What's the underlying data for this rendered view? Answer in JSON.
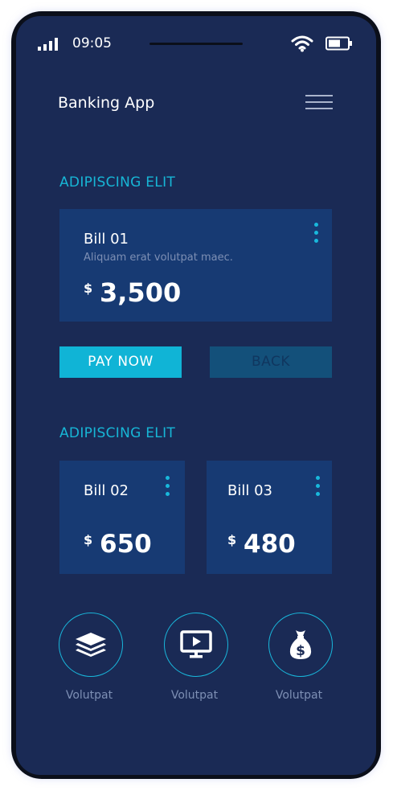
{
  "status_bar": {
    "time": "09:05"
  },
  "header": {
    "title": "Banking App"
  },
  "section1": {
    "title": "ADIPISCING ELIT",
    "bill": {
      "name": "Bill 01",
      "description": "Aliquam erat volutpat maec.",
      "currency": "$",
      "amount": "3,500"
    }
  },
  "actions": {
    "pay_label": "PAY NOW",
    "back_label": "BACK"
  },
  "section2": {
    "title": "ADIPISCING ELIT",
    "bills": [
      {
        "name": "Bill 02",
        "currency": "$",
        "amount": "650"
      },
      {
        "name": "Bill 03",
        "currency": "$",
        "amount": "480"
      }
    ]
  },
  "bottom_nav": [
    {
      "icon": "layers-icon",
      "label": "Volutpat"
    },
    {
      "icon": "monitor-play-icon",
      "label": "Volutpat"
    },
    {
      "icon": "money-bag-icon",
      "label": "Volutpat"
    }
  ],
  "colors": {
    "background": "#1a2a55",
    "card": "#173a73",
    "accent": "#10b4d6",
    "secondary_button": "#13507a"
  }
}
